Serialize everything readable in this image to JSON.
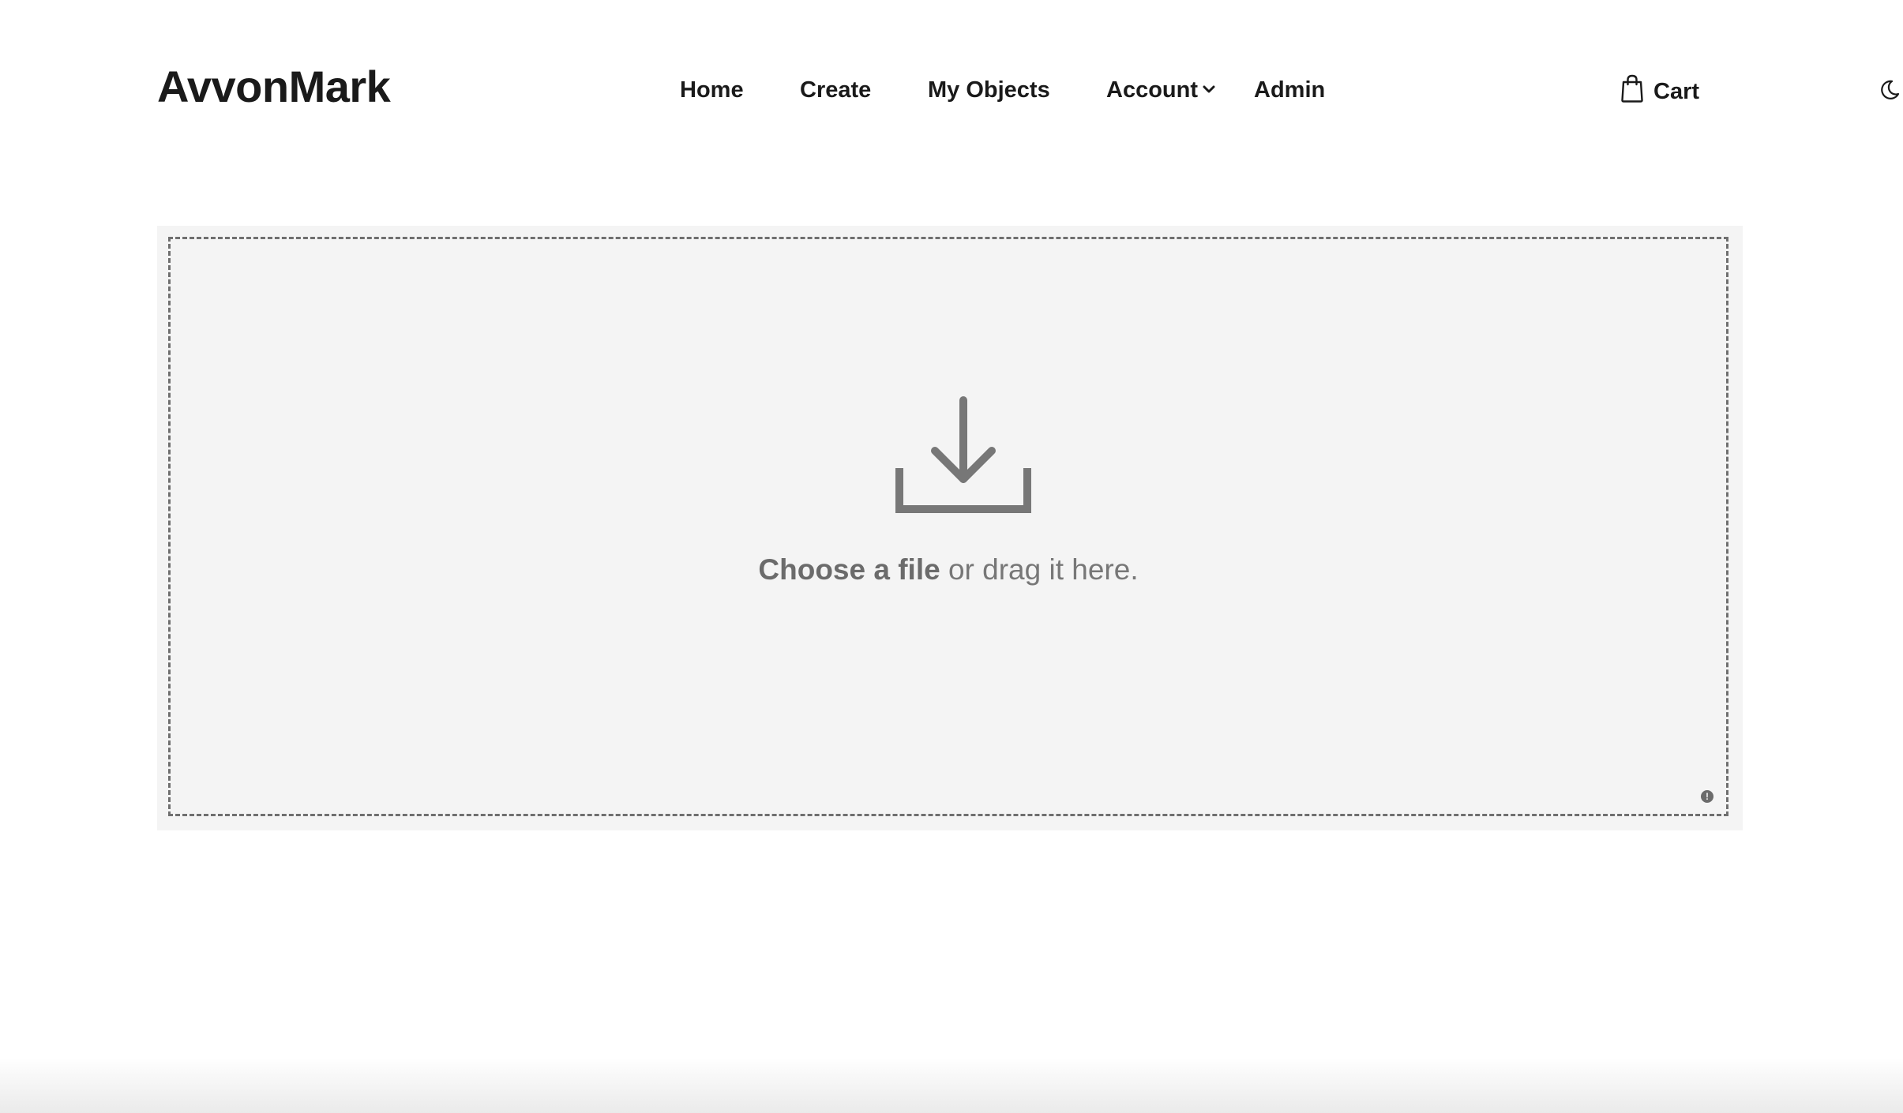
{
  "header": {
    "logo": "AvvonMark",
    "nav": {
      "home": "Home",
      "create": "Create",
      "my_objects": "My Objects",
      "account": "Account",
      "admin": "Admin"
    },
    "cart_label": "Cart",
    "icons": {
      "cart": "shopping-bag-icon",
      "account_dropdown": "chevron-down-icon",
      "theme": "moon-icon"
    }
  },
  "upload": {
    "choose_label": "Choose a file",
    "drag_label": " or drag it here.",
    "icon": "download-tray-icon",
    "info_icon": "info-icon",
    "info_glyph": "!"
  },
  "colors": {
    "text": "#1a1a1a",
    "upload_bg": "#f4f4f4",
    "upload_border": "#6f6f6f",
    "upload_icon": "#777777"
  }
}
